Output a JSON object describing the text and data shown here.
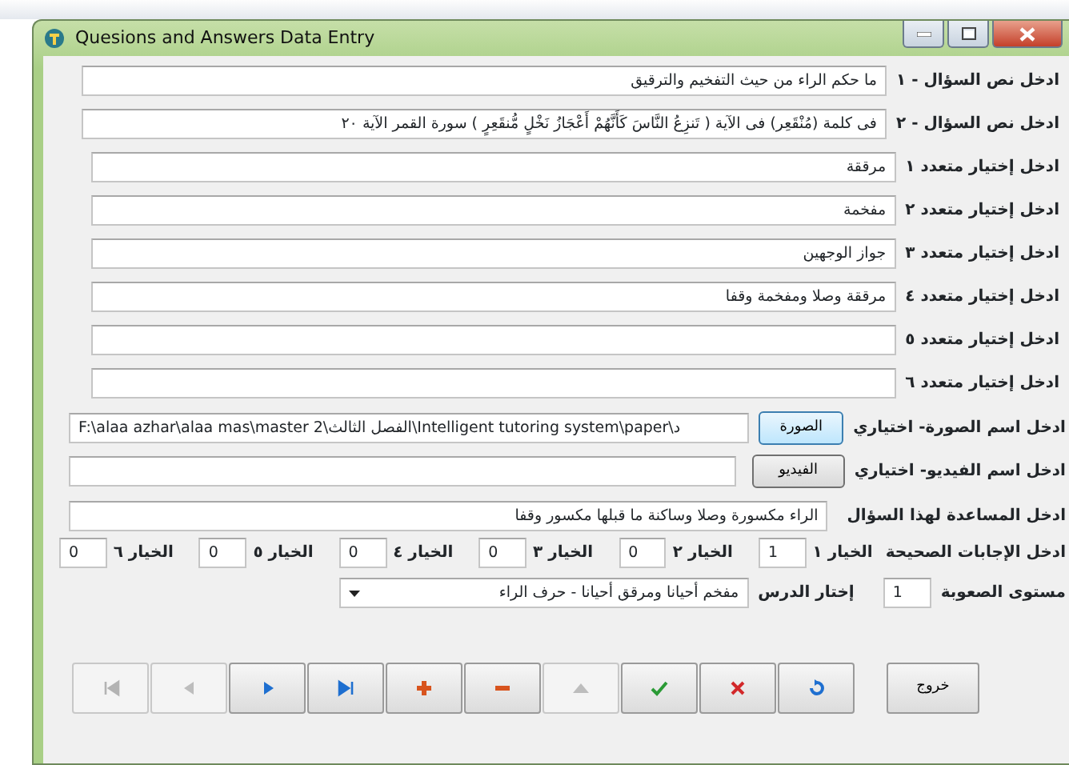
{
  "window": {
    "title": "Quesions and Answers Data Entry"
  },
  "questions": [
    {
      "label": "ادخل نص السؤال - ١",
      "value": "ما حكم الراء من حيث التفخيم والترقيق"
    },
    {
      "label": "ادخل نص السؤال - ٢",
      "value": "فى كلمة (مُنْقَعِر) فى الآية  ( تَنزِعُ النَّاسَ كَأَنَّهُمْ أَعْجَازُ نَخْلٍ مُّنقَعِرٍ ) سورة القمر  الآية ٢٠"
    }
  ],
  "choices": [
    {
      "label": "ادخل إختيار متعدد ١",
      "value": "مرققة"
    },
    {
      "label": "ادخل إختيار متعدد ٢",
      "value": "مفخمة"
    },
    {
      "label": "ادخل إختيار متعدد ٣",
      "value": "جواز الوجهين"
    },
    {
      "label": "ادخل إختيار متعدد ٤",
      "value": "مرققة وصلا ومفخمة وقفا"
    },
    {
      "label": "ادخل إختيار متعدد ٥"
    },
    {
      "label": "ادخل إختيار متعدد ٦"
    }
  ],
  "image": {
    "label": "ادخل اسم الصورة- اختياري",
    "button": "الصورة",
    "value": "F:\\alaa azhar\\alaa mas\\master 2\\الفصل الثالث\\Intelligent tutoring system\\paper\\د"
  },
  "video": {
    "label": "ادخل اسم الفيديو- اختياري",
    "button": "الفيديو"
  },
  "help": {
    "label": "ادخل المساعدة لهذا السؤال",
    "value": "الراء مكسورة وصلا وساكنة ما قبلها مكسور وقفا"
  },
  "answers": {
    "label": "ادخل الإجابات الصحيحة",
    "items": [
      {
        "label": "الخيار ١",
        "value": "1"
      },
      {
        "label": "الخيار ٢",
        "value": "0"
      },
      {
        "label": "الخيار ٣",
        "value": "0"
      },
      {
        "label": "الخيار ٤",
        "value": "0"
      },
      {
        "label": "الخيار ٥",
        "value": "0"
      },
      {
        "label": "الخيار ٦",
        "value": "0"
      }
    ]
  },
  "difficulty": {
    "label": "مستوى الصعوبة",
    "value": "1"
  },
  "lesson": {
    "label": "إختار الدرس",
    "value": "مفخم أحيانا ومرقق أحيانا - حرف الراء"
  },
  "toolbar": [
    {
      "kind": "first",
      "disabled": true
    },
    {
      "kind": "prev",
      "disabled": true
    },
    {
      "kind": "next",
      "disabled": false
    },
    {
      "kind": "last",
      "disabled": false
    },
    {
      "kind": "add",
      "disabled": false
    },
    {
      "kind": "remove",
      "disabled": false
    },
    {
      "kind": "up",
      "disabled": true
    },
    {
      "kind": "save",
      "disabled": false
    },
    {
      "kind": "cancel",
      "disabled": false
    },
    {
      "kind": "refresh",
      "disabled": false
    }
  ],
  "exit_button": "خروج"
}
